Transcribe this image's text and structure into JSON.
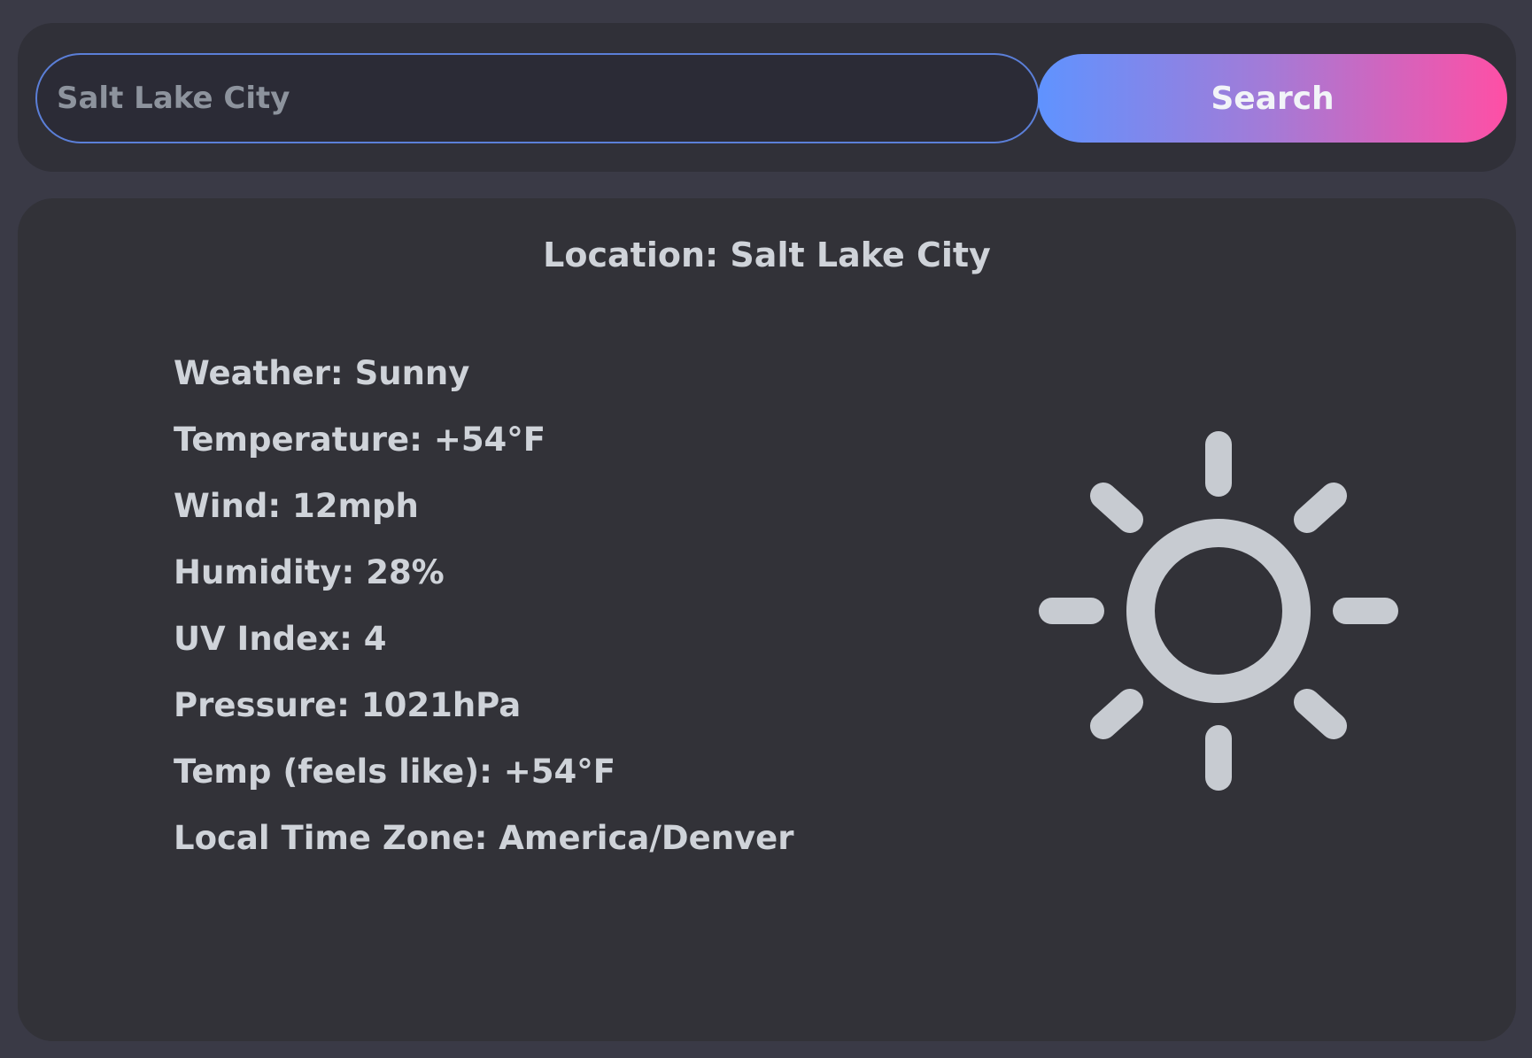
{
  "search": {
    "value": "Salt Lake City",
    "placeholder": "Salt Lake City",
    "button_label": "Search"
  },
  "weather": {
    "location": "Location: Salt Lake City",
    "details": [
      "Weather: Sunny",
      "Temperature: +54°F",
      "Wind: 12mph",
      "Humidity: 28%",
      "UV Index: 4",
      "Pressure: 1021hPa",
      "Temp (feels like): +54°F",
      "Local Time Zone: America/Denver"
    ],
    "icon": "sun-icon"
  },
  "colors": {
    "page_background": "#3a3a46",
    "panel_background": "#303038",
    "card_background": "#323238",
    "text": "#cfd3d9",
    "input_border": "#5b7fd8",
    "button_gradient_start": "#5f93ff",
    "button_gradient_end": "#ff4fa5",
    "icon": "#c7cbd1"
  }
}
